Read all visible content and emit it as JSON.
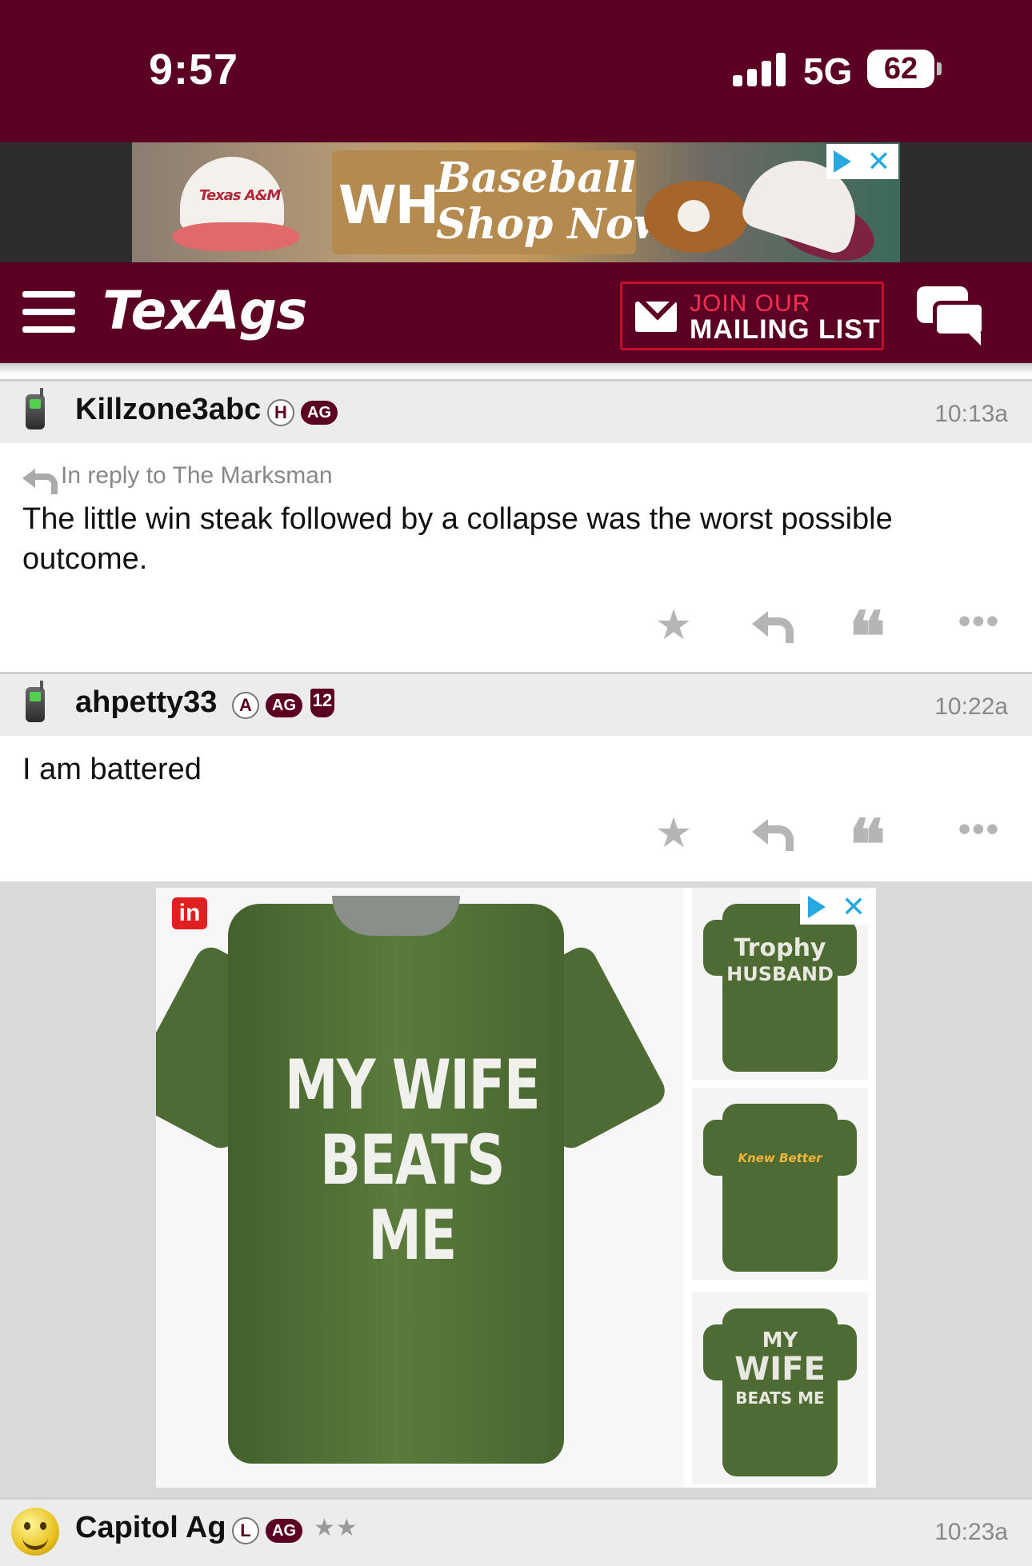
{
  "status_bar": {
    "time": "9:57",
    "network": "5G",
    "battery": "62"
  },
  "top_ad": {
    "brand": "WH",
    "slogan_line1": "Baseball",
    "slogan_line2": "Shop Now",
    "cap_logo": "Texas A&M"
  },
  "nav": {
    "logo": "TexAgs",
    "mailing_line1": "JOIN OUR",
    "mailing_line2": "MAILING LIST"
  },
  "posts": [
    {
      "username": "Killzone3abc",
      "badges": [
        "H",
        "AG"
      ],
      "time": "10:13a",
      "reply_to": "In reply to The Marksman",
      "body": "The little win steak followed by a collapse was the worst possible outcome."
    },
    {
      "username": "ahpetty33",
      "badges": [
        "A",
        "AG",
        "12"
      ],
      "time": "10:22a",
      "body": "I am battered"
    },
    {
      "username": "Capitol Ag",
      "badges": [
        "L",
        "AG"
      ],
      "stars": "★★",
      "time": "10:23a"
    }
  ],
  "actions": {
    "star": "★",
    "quote": "❝",
    "more": "•••"
  },
  "bottom_ad": {
    "badge": "in",
    "main_text_line1": "MY WIFE",
    "main_text_line2": "BEATS ME",
    "thumb1_line1": "Trophy",
    "thumb1_line2": "HUSBAND",
    "thumb2_text": "Knew Better",
    "thumb3_line1": "MY",
    "thumb3_line2": "WIFE",
    "thumb3_line3": "BEATS ME"
  },
  "colors": {
    "maroon": "#5c0023",
    "accent_red": "#c8102e",
    "ad_blue": "#28a8e0"
  }
}
